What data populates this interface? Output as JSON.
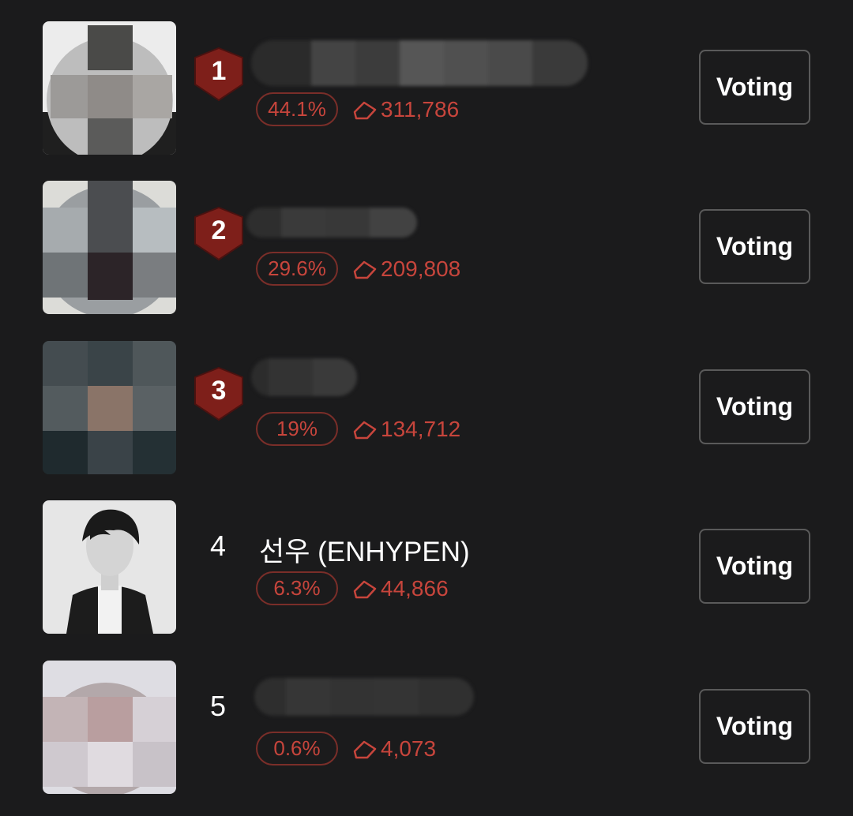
{
  "colors": {
    "background": "#1b1b1c",
    "accent_red": "#c7453c",
    "badge_red": "#7e1f1a",
    "pill_border": "#7a2e29",
    "button_border": "#5a5a5a"
  },
  "ranking": [
    {
      "rank": "1",
      "name": "",
      "percent": "44.1%",
      "votes": "311,786",
      "button_label": "Voting",
      "rank_style": "badge",
      "icon": "vote-ticket-icon"
    },
    {
      "rank": "2",
      "name": "",
      "percent": "29.6%",
      "votes": "209,808",
      "button_label": "Voting",
      "rank_style": "badge",
      "icon": "vote-ticket-icon"
    },
    {
      "rank": "3",
      "name": "",
      "percent": "19%",
      "votes": "134,712",
      "button_label": "Voting",
      "rank_style": "badge",
      "icon": "vote-ticket-icon"
    },
    {
      "rank": "4",
      "name": "선우 (ENHYPEN)",
      "percent": "6.3%",
      "votes": "44,866",
      "button_label": "Voting",
      "rank_style": "plain",
      "icon": "vote-ticket-icon"
    },
    {
      "rank": "5",
      "name": "",
      "percent": "0.6%",
      "votes": "4,073",
      "button_label": "Voting",
      "rank_style": "plain",
      "icon": "vote-ticket-icon"
    }
  ]
}
